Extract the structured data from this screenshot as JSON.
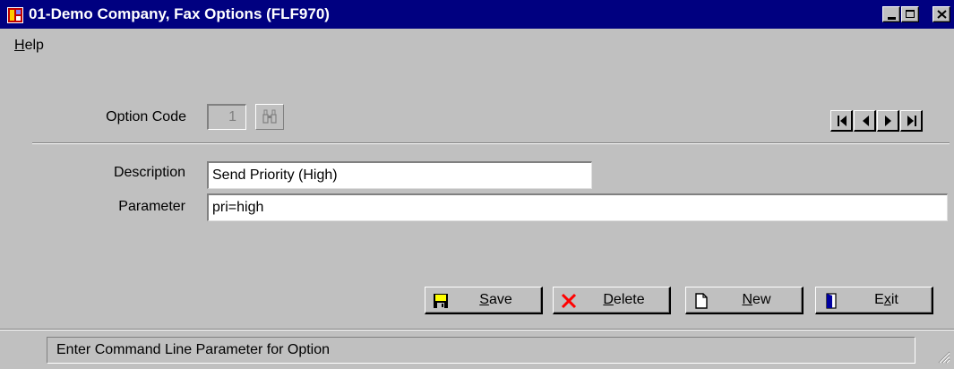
{
  "window": {
    "title": "01-Demo Company, Fax Options (FLF970)",
    "titlebar_color": "#000080"
  },
  "menu": {
    "help_accel": "H",
    "help_rest": "elp"
  },
  "form": {
    "option_code_label": "Option Code",
    "option_code_value": "1",
    "description_label": "Description",
    "description_value": "Send Priority (High)",
    "parameter_label": "Parameter",
    "parameter_value": "pri=high"
  },
  "icons": {
    "lookup": "binoculars-icon",
    "nav_first": "first-record-icon",
    "nav_prev": "previous-record-icon",
    "nav_next": "next-record-icon",
    "nav_last": "last-record-icon",
    "save": "floppy-disk-icon",
    "delete": "red-x-icon",
    "new": "blank-page-icon",
    "exit": "door-icon"
  },
  "buttons": {
    "save_accel": "S",
    "save_rest": "ave",
    "delete_accel": "D",
    "delete_rest": "elete",
    "new_accel": "N",
    "new_rest": "ew",
    "exit_pre": "E",
    "exit_accel": "x",
    "exit_rest": "it"
  },
  "status": {
    "message": "Enter Command Line Parameter for Option"
  }
}
